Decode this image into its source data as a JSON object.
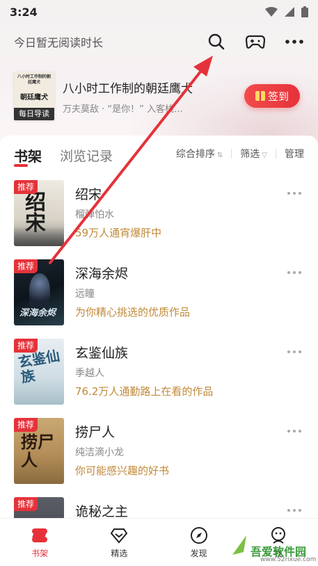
{
  "status_bar": {
    "time": "3:24"
  },
  "header": {
    "reading_time": "今日暂无阅读时长",
    "icons": [
      "search-icon",
      "gamepad-icon",
      "more-icon"
    ]
  },
  "daily_pick": {
    "cover_title_small": "八小时工作制的朝廷鹰犬",
    "cover_title_big": "朝廷鹰犬",
    "cover_tag": "每日导读",
    "title": "八小时工作制的朝廷鹰犬",
    "subtitle": "万夫莫敌 · “是你！” 入客栈…",
    "sign_in_label": "签到"
  },
  "tabs": {
    "bookshelf": "书架",
    "history": "浏览记录"
  },
  "filters": {
    "sort": "综合排序",
    "filter": "筛选",
    "manage": "管理"
  },
  "books": [
    {
      "badge": "推荐",
      "cover_text": "绍宋",
      "title": "绍宋",
      "author": "榴弹怕水",
      "desc": "59万人通宵爆肝中"
    },
    {
      "badge": "推荐",
      "cover_text": "深海余烬",
      "title": "深海余烬",
      "author": "远瞳",
      "desc": "为你精心挑选的优质作品"
    },
    {
      "badge": "推荐",
      "cover_text": "玄鉴仙族",
      "title": "玄鉴仙族",
      "author": "季越人",
      "desc": "76.2万人通勤路上在看的作品"
    },
    {
      "badge": "推荐",
      "cover_text": "捞尸人",
      "title": "捞尸人",
      "author": "纯洁滴小龙",
      "desc": "你可能感兴趣的好书"
    },
    {
      "badge": "推荐",
      "cover_text": "诡秘之主",
      "title": "诡秘之主",
      "author": "",
      "desc": ""
    }
  ],
  "bottom_nav": [
    {
      "label": "书架",
      "icon": "bookshelf-icon",
      "active": true
    },
    {
      "label": "精选",
      "icon": "diamond-icon",
      "active": false
    },
    {
      "label": "发现",
      "icon": "compass-icon",
      "active": false
    },
    {
      "label": "我",
      "icon": "profile-icon",
      "active": false
    }
  ],
  "watermark": {
    "text": "吾爱软件园",
    "url": "www.52rixue.com"
  },
  "colors": {
    "accent": "#e5323a",
    "desc": "#c08a3a"
  }
}
